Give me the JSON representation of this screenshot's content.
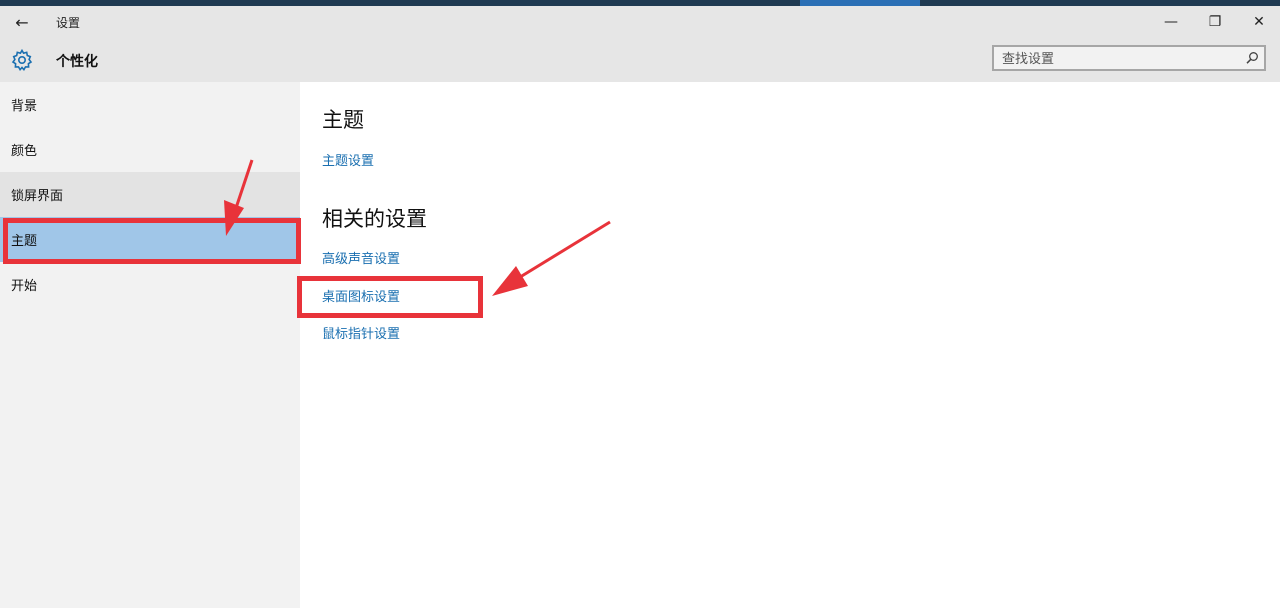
{
  "window": {
    "app_title": "设置",
    "back_glyph": "←",
    "minimize_glyph": "—",
    "maximize_glyph": "❐",
    "close_glyph": "✕"
  },
  "header": {
    "title": "个性化",
    "search_placeholder": "查找设置"
  },
  "sidebar": {
    "items": [
      {
        "label": "背景"
      },
      {
        "label": "颜色"
      },
      {
        "label": "锁屏界面"
      },
      {
        "label": "主题"
      },
      {
        "label": "开始"
      }
    ]
  },
  "content": {
    "theme_heading": "主题",
    "theme_settings_link": "主题设置",
    "related_heading": "相关的设置",
    "related_links": [
      {
        "label": "高级声音设置"
      },
      {
        "label": "桌面图标设置"
      },
      {
        "label": "鼠标指针设置"
      }
    ]
  },
  "colors": {
    "accent": "#1a6fb0",
    "selected_bg": "#a0c6e8",
    "annotation": "#e8333a"
  },
  "icons": {
    "back": "back-arrow-icon",
    "gear": "gear-icon",
    "search": "search-icon"
  }
}
